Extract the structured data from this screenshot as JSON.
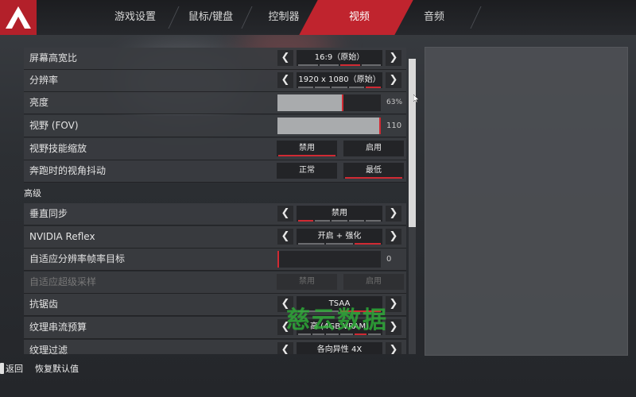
{
  "nav": {
    "tabs": [
      {
        "label": "游戏设置"
      },
      {
        "label": "鼠标/键盘"
      },
      {
        "label": "控制器"
      },
      {
        "label": "视频"
      },
      {
        "label": "音频"
      }
    ],
    "active_tab": "视频"
  },
  "settings": {
    "rows": [
      {
        "label": "屏幕高宽比",
        "type": "selector",
        "value": "16:9（原始）"
      },
      {
        "label": "分辨率",
        "type": "selector",
        "value": "1920 x 1080（原始）"
      },
      {
        "label": "亮度",
        "type": "slider",
        "display": "63%",
        "level": 0.63
      },
      {
        "label": "视野 (FOV)",
        "type": "slider",
        "display": "110",
        "level": 1.0
      },
      {
        "label": "视野技能缩放",
        "type": "toggle",
        "options": [
          "禁用",
          "启用"
        ],
        "selected": 0
      },
      {
        "label": "奔跑时的视角抖动",
        "type": "toggle",
        "options": [
          "正常",
          "最低"
        ],
        "selected": 1
      }
    ],
    "advanced_header": "高级",
    "advanced_rows": [
      {
        "label": "垂直同步",
        "type": "selector",
        "value": "禁用"
      },
      {
        "label": "NVIDIA Reflex",
        "type": "selector",
        "value": "开启 + 强化"
      },
      {
        "label": "自适应分辨率帧率目标",
        "type": "slider",
        "display": "0",
        "level": 0.0
      },
      {
        "label": "自适应超级采样",
        "type": "toggle",
        "options": [
          "禁用",
          "启用"
        ],
        "selected": -1,
        "disabled": true
      },
      {
        "label": "抗锯齿",
        "type": "selector",
        "value": "TSAA"
      },
      {
        "label": "纹理串流预算",
        "type": "selector",
        "value": "高 (4GB VRAM)"
      },
      {
        "label": "纹理过滤",
        "type": "selector",
        "value": "各向异性 4X"
      }
    ]
  },
  "footer": {
    "back_label": "返回",
    "reset_label": "恢复默认值"
  },
  "watermark": "慈云数据",
  "colors": {
    "accent": "#c0242e",
    "panel": "#3a3c40",
    "slider_fill": "#a9abad"
  }
}
